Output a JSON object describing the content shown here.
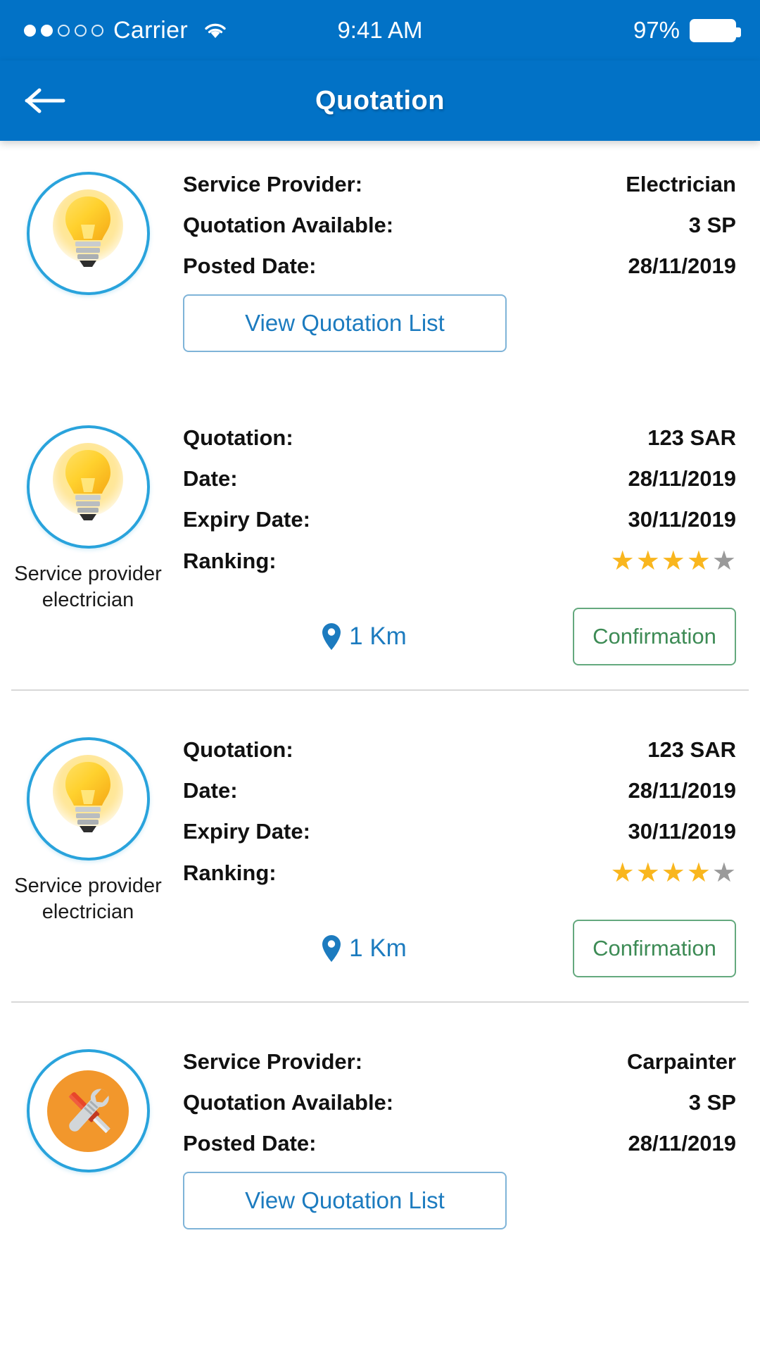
{
  "status_bar": {
    "carrier": "Carrier",
    "time": "9:41 AM",
    "battery_percent": "97%",
    "signal_dots_filled": 2,
    "signal_dots_total": 5,
    "wifi_icon": "wifi-icon",
    "battery_icon": "battery-icon"
  },
  "header": {
    "title": "Quotation",
    "back_icon": "back-arrow-icon",
    "background_color": "#0272C6"
  },
  "colors": {
    "header_blue": "#0272C6",
    "link_blue": "#1C7BBF",
    "circle_blue": "#29A3DC",
    "star_gold": "#F9B61E",
    "star_gray": "#9A9A9A",
    "confirm_green": "#3D8B55",
    "divider_gray": "#D8D8D8",
    "tool_orange": "#F2972C"
  },
  "cards": [
    {
      "type": "summary",
      "icon": "lightbulb-icon",
      "rows": [
        {
          "label": "Service Provider:",
          "value": "Electrician"
        },
        {
          "label": "Quotation Available:",
          "value": "3 SP"
        },
        {
          "label": "Posted Date:",
          "value": "28/11/2019"
        }
      ],
      "button_label": "View Quotation List"
    },
    {
      "type": "quote",
      "icon": "lightbulb-icon",
      "caption": "Service provider electrician",
      "rows": [
        {
          "label": "Quotation:",
          "value": "123 SAR"
        },
        {
          "label": "Date:",
          "value": "28/11/2019"
        },
        {
          "label": "Expiry Date:",
          "value": "30/11/2019"
        }
      ],
      "ranking_label": "Ranking:",
      "rating": 4,
      "rating_max": 5,
      "distance": "1 Km",
      "confirm_label": "Confirmation"
    },
    {
      "type": "quote",
      "icon": "lightbulb-icon",
      "caption": "Service provider electrician",
      "rows": [
        {
          "label": "Quotation:",
          "value": "123 SAR"
        },
        {
          "label": "Date:",
          "value": "28/11/2019"
        },
        {
          "label": "Expiry Date:",
          "value": "30/11/2019"
        }
      ],
      "ranking_label": "Ranking:",
      "rating": 4,
      "rating_max": 5,
      "distance": "1 Km",
      "confirm_label": "Confirmation"
    },
    {
      "type": "summary",
      "icon": "tools-icon",
      "rows": [
        {
          "label": "Service Provider:",
          "value": "Carpainter"
        },
        {
          "label": "Quotation Available:",
          "value": "3 SP"
        },
        {
          "label": "Posted Date:",
          "value": "28/11/2019"
        }
      ],
      "button_label": "View Quotation List"
    }
  ]
}
